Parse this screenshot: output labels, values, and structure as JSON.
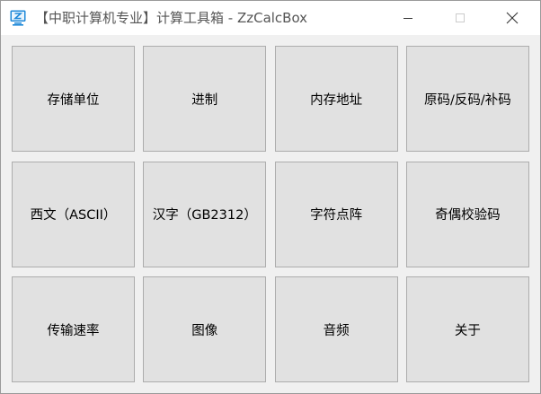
{
  "window": {
    "title": "【中职计算机专业】计算工具箱 - ZzCalcBox",
    "icon": "app-z-icon",
    "controls": {
      "minimize_icon": "minimize-icon",
      "maximize_icon": "maximize-icon",
      "close_icon": "close-icon"
    }
  },
  "colors": {
    "icon_blue": "#1e88d8",
    "button_bg": "#e1e1e1",
    "button_border": "#adadad",
    "window_bg": "#f0f0f0"
  },
  "tools": [
    {
      "id": "storage-units",
      "label": "存储单位"
    },
    {
      "id": "number-base",
      "label": "进制"
    },
    {
      "id": "memory-address",
      "label": "内存地址"
    },
    {
      "id": "sign-codes",
      "label": "原码/反码/补码"
    },
    {
      "id": "western-ascii",
      "label": "西文（ASCII）"
    },
    {
      "id": "chinese-gb2312",
      "label": "汉字（GB2312）"
    },
    {
      "id": "glyph-matrix",
      "label": "字符点阵"
    },
    {
      "id": "parity-check",
      "label": "奇偶校验码"
    },
    {
      "id": "transfer-rate",
      "label": "传输速率"
    },
    {
      "id": "image",
      "label": "图像"
    },
    {
      "id": "audio",
      "label": "音频"
    },
    {
      "id": "about",
      "label": "关于"
    }
  ]
}
